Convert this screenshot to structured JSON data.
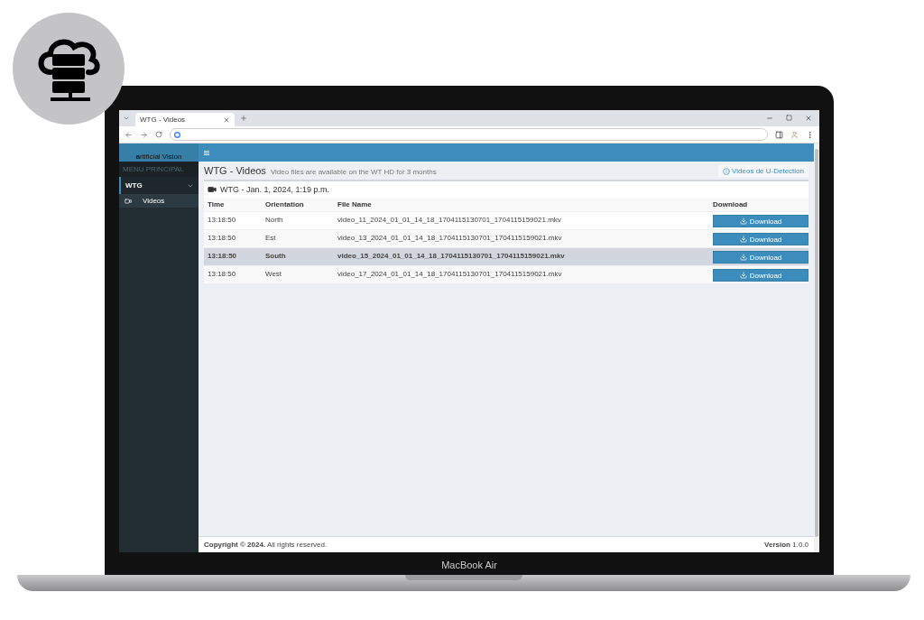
{
  "device_label": "MacBook Air",
  "browser": {
    "tabs": [
      {
        "title": "WTG - Videos",
        "selected": true
      }
    ]
  },
  "sidebar": {
    "logo": "rtificial Vision",
    "logo_initial": "a",
    "section": "MENU PRINCIPAL",
    "items": [
      {
        "label": "WTG",
        "expanded": true,
        "children": [
          {
            "label": "Videos",
            "selected": true
          }
        ]
      }
    ]
  },
  "page": {
    "title": "WTG - Videos",
    "subtitle": "Video files are available on the WT HD for 3 months",
    "link": "Videos de U-Detection"
  },
  "box": {
    "title": "WTG - Jan. 1, 2024, 1:19 p.m.",
    "table": {
      "columns": [
        "Time",
        "Orientation",
        "File Name",
        "Download"
      ],
      "rows": [
        {
          "time": "13:18:50",
          "orientation": "North",
          "file": "video_11_2024_01_01_14_18_1704115130701_1704115159021.mkv",
          "button": "Download",
          "selected": false
        },
        {
          "time": "13:18:50",
          "orientation": "Est",
          "file": "video_13_2024_01_01_14_18_1704115130701_1704115159021.mkv",
          "button": "Download",
          "selected": false
        },
        {
          "time": "13:18:50",
          "orientation": "South",
          "file": "video_15_2024_01_01_14_18_1704115130701_1704115159021.mkv",
          "button": "Download",
          "selected": true
        },
        {
          "time": "13:18:50",
          "orientation": "West",
          "file": "video_17_2024_01_01_14_18_1704115130701_1704115159021.mkv",
          "button": "Download",
          "selected": false
        }
      ]
    }
  },
  "footer": {
    "copyright": "**Copyright © 2024.** All rights reserved.",
    "version": "**Version** 1.0.0"
  }
}
